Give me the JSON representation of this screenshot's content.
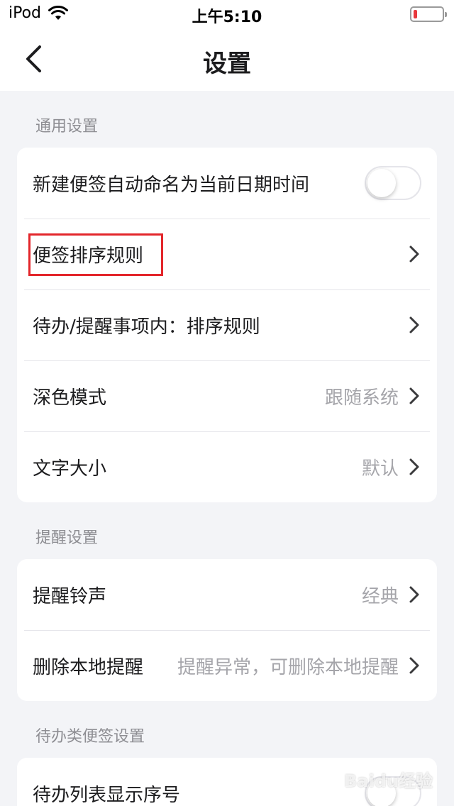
{
  "status_bar": {
    "carrier": "iPod",
    "time": "上午5:10",
    "battery_level": 0.12,
    "battery_color": "#e8383d"
  },
  "nav": {
    "title": "设置",
    "back_icon": "chevron-left-icon"
  },
  "sections": [
    {
      "title": "通用设置",
      "rows": [
        {
          "label": "新建便签自动命名为当前日期时间",
          "type": "toggle",
          "on": false
        },
        {
          "label": "便签排序规则",
          "type": "link",
          "value": "",
          "highlighted": true
        },
        {
          "label": "待办/提醒事项内：排序规则",
          "type": "link",
          "value": ""
        },
        {
          "label": "深色模式",
          "type": "link",
          "value": "跟随系统"
        },
        {
          "label": "文字大小",
          "type": "link",
          "value": "默认"
        }
      ]
    },
    {
      "title": "提醒设置",
      "rows": [
        {
          "label": "提醒铃声",
          "type": "link",
          "value": "经典"
        },
        {
          "label": "删除本地提醒",
          "type": "link",
          "value": "提醒异常，可删除本地提醒"
        }
      ]
    },
    {
      "title": "待办类便签设置",
      "rows": [
        {
          "label": "待办列表显示序号",
          "type": "toggle",
          "on": false
        }
      ]
    }
  ],
  "watermark": "Baidu经验"
}
